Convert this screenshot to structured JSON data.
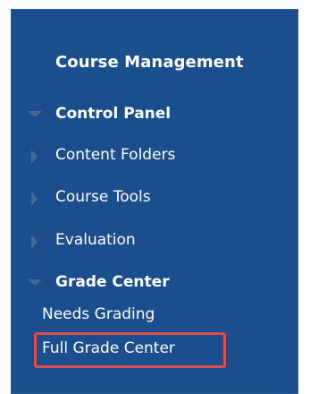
{
  "menu": {
    "heading": "Course Management",
    "items": [
      {
        "label": "Control Panel",
        "expanded": true
      },
      {
        "label": "Content Folders",
        "expanded": false
      },
      {
        "label": "Course Tools",
        "expanded": false
      },
      {
        "label": "Evaluation",
        "expanded": false
      },
      {
        "label": "Grade Center",
        "expanded": true
      }
    ],
    "grade_center_children": [
      "Needs Grading",
      "Full Grade Center"
    ],
    "colors": {
      "panel_background": "#1b4e8d",
      "highlight_border": "#e04b4b",
      "arrow_color": "#49678f"
    },
    "icons": {
      "expanded": "triangle-down-icon",
      "collapsed": "triangle-right-icon"
    }
  }
}
